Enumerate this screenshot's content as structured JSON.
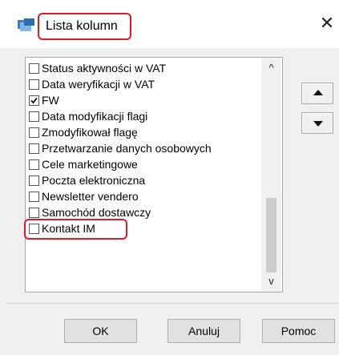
{
  "window": {
    "title": "Lista kolumn",
    "close_glyph": "✕"
  },
  "list": {
    "items": [
      {
        "label": "Status aktywności w VAT",
        "checked": false
      },
      {
        "label": "Data weryfikacji w VAT",
        "checked": false
      },
      {
        "label": "FW",
        "checked": true
      },
      {
        "label": "Data modyfikacji flagi",
        "checked": false
      },
      {
        "label": "Zmodyfikował flagę",
        "checked": false
      },
      {
        "label": "Przetwarzanie danych osobowych",
        "checked": false
      },
      {
        "label": "Cele marketingowe",
        "checked": false
      },
      {
        "label": "Poczta elektroniczna",
        "checked": false
      },
      {
        "label": "Newsletter vendero",
        "checked": false
      },
      {
        "label": "Samochód dostawczy",
        "checked": false
      },
      {
        "label": "Kontakt IM",
        "checked": false
      }
    ],
    "scroll_up_glyph": "^",
    "scroll_down_glyph": "v"
  },
  "buttons": {
    "ok": "OK",
    "cancel": "Anuluj",
    "help": "Pomoc"
  },
  "icons": {
    "app": "app-icon",
    "move_up": "triangle-up-icon",
    "move_down": "triangle-down-icon"
  },
  "colors": {
    "highlight": "#e01b24",
    "dialog_bg": "#f0f0f0"
  }
}
